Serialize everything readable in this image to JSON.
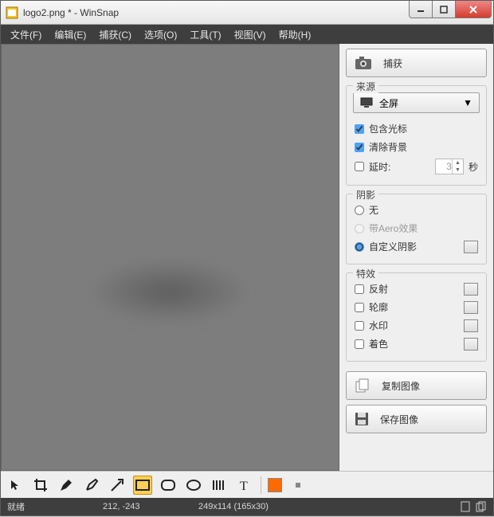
{
  "title": "logo2.png * - WinSnap",
  "menu": {
    "file": "文件(F)",
    "edit": "编辑(E)",
    "capture": "捕获(C)",
    "options": "选项(O)",
    "tools": "工具(T)",
    "view": "视图(V)",
    "help": "帮助(H)"
  },
  "panel": {
    "capture_btn": "捕获",
    "source": {
      "legend": "来源",
      "mode": "全屏",
      "include_cursor": "包含光标",
      "clear_bg": "清除背景",
      "delay_label": "延时:",
      "delay_value": "3",
      "delay_unit": "秒"
    },
    "shadow": {
      "legend": "阴影",
      "none": "无",
      "aero": "带Aero效果",
      "custom": "自定义阴影"
    },
    "effects": {
      "legend": "特效",
      "reflection": "反射",
      "outline": "轮廓",
      "watermark": "水印",
      "colorize": "着色"
    },
    "copy_btn": "复制图像",
    "save_btn": "保存图像"
  },
  "status": {
    "ready": "就绪",
    "coords": "212, -243",
    "dims": "249x114 (165x30)"
  },
  "colors": {
    "swatch": "#ff6a00"
  }
}
